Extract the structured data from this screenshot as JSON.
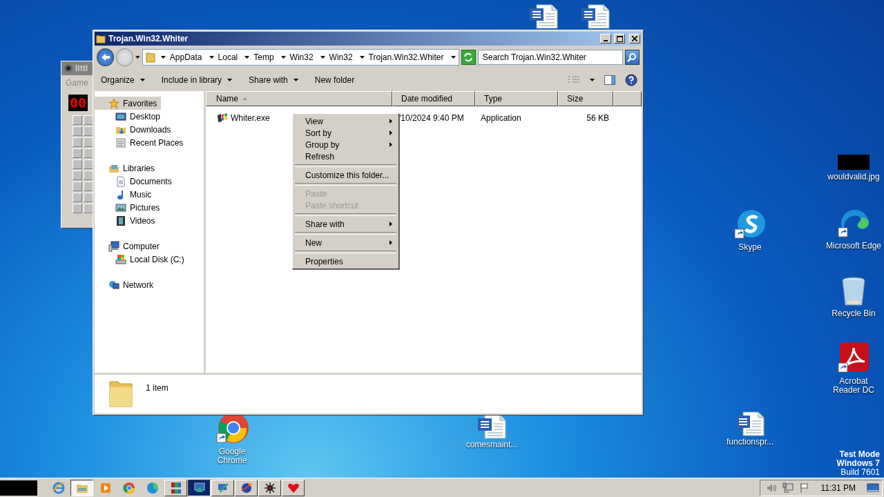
{
  "back_window": {
    "title": "littl",
    "menu": "Game",
    "counter": "00"
  },
  "explorer": {
    "title": "Trojan.Win32.Whiter",
    "breadcrumb": [
      "AppData",
      "Local",
      "Temp",
      "Win32",
      "Win32",
      "Trojan.Win32.Whiter"
    ],
    "search": {
      "placeholder": "Search Trojan.Win32.Whiter"
    },
    "toolbar": [
      {
        "label": "Organize",
        "menu": true
      },
      {
        "label": "Include in library",
        "menu": true
      },
      {
        "label": "Share with",
        "menu": true
      },
      {
        "label": "New folder",
        "menu": false
      }
    ],
    "nav": [
      {
        "label": "Favorites",
        "kind": "star",
        "selected": true,
        "children": [
          {
            "label": "Desktop",
            "kind": "desktop",
            "selected": false
          },
          {
            "label": "Downloads",
            "kind": "downloads",
            "selected": false
          },
          {
            "label": "Recent Places",
            "kind": "recent",
            "selected": false
          }
        ]
      },
      {
        "label": "Libraries",
        "kind": "libraries",
        "selected": false,
        "children": [
          {
            "label": "Documents",
            "kind": "documents",
            "selected": false
          },
          {
            "label": "Music",
            "kind": "music",
            "selected": false
          },
          {
            "label": "Pictures",
            "kind": "pictures",
            "selected": false
          },
          {
            "label": "Videos",
            "kind": "videos",
            "selected": false
          }
        ]
      },
      {
        "label": "Computer",
        "kind": "computer",
        "selected": false,
        "children": [
          {
            "label": "Local Disk (C:)",
            "kind": "disk",
            "selected": false
          }
        ]
      },
      {
        "label": "Network",
        "kind": "network",
        "selected": false
      }
    ],
    "columns": [
      {
        "label": "Name",
        "sorted": true
      },
      {
        "label": "Date modified",
        "sorted": false
      },
      {
        "label": "Type",
        "sorted": false
      },
      {
        "label": "Size",
        "sorted": false
      }
    ],
    "files": [
      {
        "name": "Whiter.exe",
        "date": "/10/2024 9:40 PM",
        "type": "Application",
        "size": "56 KB"
      }
    ],
    "status": "1 item"
  },
  "context_menu": [
    {
      "kind": "item",
      "label": "View",
      "submenu": true,
      "disabled": false
    },
    {
      "kind": "item",
      "label": "Sort by",
      "submenu": true,
      "disabled": false
    },
    {
      "kind": "item",
      "label": "Group by",
      "submenu": true,
      "disabled": false
    },
    {
      "kind": "item",
      "label": "Refresh",
      "submenu": false,
      "disabled": false
    },
    {
      "kind": "separator"
    },
    {
      "kind": "item",
      "label": "Customize this folder...",
      "submenu": false,
      "disabled": false
    },
    {
      "kind": "separator"
    },
    {
      "kind": "item",
      "label": "Paste",
      "submenu": false,
      "disabled": true
    },
    {
      "kind": "item",
      "label": "Paste shortcut",
      "submenu": false,
      "disabled": true
    },
    {
      "kind": "separator"
    },
    {
      "kind": "item",
      "label": "Share with",
      "submenu": true,
      "disabled": false
    },
    {
      "kind": "separator"
    },
    {
      "kind": "item",
      "label": "New",
      "submenu": true,
      "disabled": false
    },
    {
      "kind": "separator"
    },
    {
      "kind": "item",
      "label": "Properties",
      "submenu": false,
      "disabled": false
    }
  ],
  "desktop_icons": [
    {
      "kind": "word"
    },
    {
      "kind": "word"
    },
    {
      "kind": "chrome",
      "label": "Google Chrome"
    },
    {
      "kind": "word",
      "label": "comesmaint..."
    },
    {
      "kind": "word",
      "label": "functionspr..."
    },
    {
      "kind": "image",
      "label": "wouldvalid.jpg"
    },
    {
      "kind": "skype",
      "label": "Skype"
    },
    {
      "kind": "edge",
      "label": "Microsoft Edge"
    },
    {
      "kind": "recycle",
      "label": "Recycle Bin"
    },
    {
      "kind": "acrobat",
      "label": "Acrobat Reader DC"
    }
  ],
  "system_info": [
    "Test Mode",
    "Windows 7",
    "Build 7601"
  ],
  "taskbar": {
    "apps": [
      {
        "kind": "ie",
        "active": false
      },
      {
        "kind": "explorer",
        "active": true
      },
      {
        "kind": "media",
        "active": false
      },
      {
        "kind": "chrome",
        "active": false
      },
      {
        "kind": "edge",
        "active": false
      },
      {
        "kind": "archive",
        "active": false
      },
      {
        "kind": "monitor",
        "active": true
      },
      {
        "kind": "setup",
        "active": false
      },
      {
        "kind": "globe",
        "active": false
      },
      {
        "kind": "bug",
        "active": false
      },
      {
        "kind": "heart",
        "active": false
      }
    ],
    "clock": "11:31 PM"
  }
}
